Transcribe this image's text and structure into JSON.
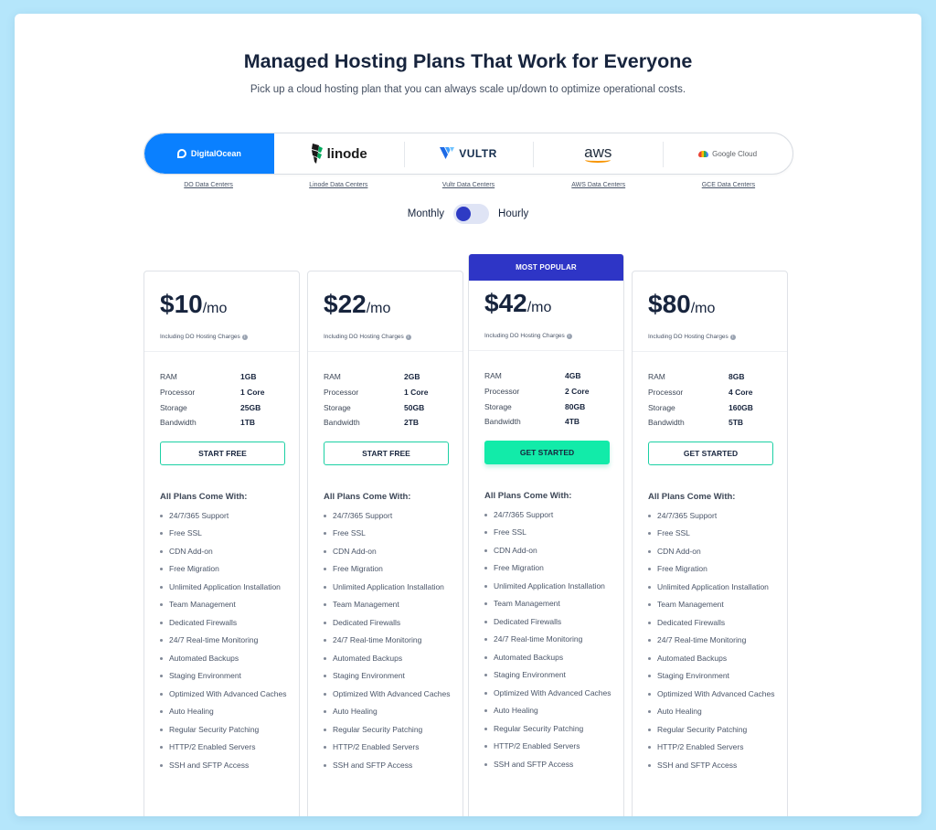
{
  "header": {
    "title": "Managed Hosting Plans That Work for Everyone",
    "subtitle": "Pick up a cloud hosting plan that you can always scale up/down to optimize operational costs."
  },
  "providers": [
    {
      "name": "DigitalOcean",
      "icon": "digitalocean-logo-icon",
      "active": true,
      "dc_link": "DO Data Centers"
    },
    {
      "name": "linode",
      "icon": "linode-logo-icon",
      "active": false,
      "dc_link": "Linode Data Centers"
    },
    {
      "name": "VULTR",
      "icon": "vultr-logo-icon",
      "active": false,
      "dc_link": "Vultr Data Centers"
    },
    {
      "name": "aws",
      "icon": "aws-logo-icon",
      "active": false,
      "dc_link": "AWS Data Centers"
    },
    {
      "name": "Google Cloud",
      "icon": "google-cloud-logo-icon",
      "active": false,
      "dc_link": "GCE Data Centers"
    }
  ],
  "billing_toggle": {
    "left": "Monthly",
    "right": "Hourly",
    "selected": "Monthly"
  },
  "colors": {
    "accent_blue": "#0a80ff",
    "popular_band": "#2e35c6",
    "cta_green": "#12eba9",
    "background": "#b5e6fb"
  },
  "plans": [
    {
      "price": "$10",
      "unit": "/mo",
      "including": "Including DO Hosting Charges",
      "specs": [
        {
          "label": "RAM",
          "value": "1GB"
        },
        {
          "label": "Processor",
          "value": "1 Core"
        },
        {
          "label": "Storage",
          "value": "25GB"
        },
        {
          "label": "Bandwidth",
          "value": "1TB"
        }
      ],
      "cta": "START FREE"
    },
    {
      "price": "$22",
      "unit": "/mo",
      "including": "Including DO Hosting Charges",
      "specs": [
        {
          "label": "RAM",
          "value": "2GB"
        },
        {
          "label": "Processor",
          "value": "1 Core"
        },
        {
          "label": "Storage",
          "value": "50GB"
        },
        {
          "label": "Bandwidth",
          "value": "2TB"
        }
      ],
      "cta": "START FREE"
    },
    {
      "badge": "MOST POPULAR",
      "price": "$42",
      "unit": "/mo",
      "including": "Including DO Hosting Charges",
      "specs": [
        {
          "label": "RAM",
          "value": "4GB"
        },
        {
          "label": "Processor",
          "value": "2 Core"
        },
        {
          "label": "Storage",
          "value": "80GB"
        },
        {
          "label": "Bandwidth",
          "value": "4TB"
        }
      ],
      "cta": "GET STARTED"
    },
    {
      "price": "$80",
      "unit": "/mo",
      "including": "Including DO Hosting Charges",
      "specs": [
        {
          "label": "RAM",
          "value": "8GB"
        },
        {
          "label": "Processor",
          "value": "4 Core"
        },
        {
          "label": "Storage",
          "value": "160GB"
        },
        {
          "label": "Bandwidth",
          "value": "5TB"
        }
      ],
      "cta": "GET STARTED"
    }
  ],
  "features_title": "All Plans Come With:",
  "features": [
    "24/7/365 Support",
    "Free SSL",
    "CDN Add-on",
    "Free Migration",
    "Unlimited Application Installation",
    "Team Management",
    "Dedicated Firewalls",
    "24/7 Real-time Monitoring",
    "Automated Backups",
    "Staging Environment",
    "Optimized With Advanced Caches",
    "Auto Healing",
    "Regular Security Patching",
    "HTTP/2 Enabled Servers",
    "SSH and SFTP Access"
  ]
}
